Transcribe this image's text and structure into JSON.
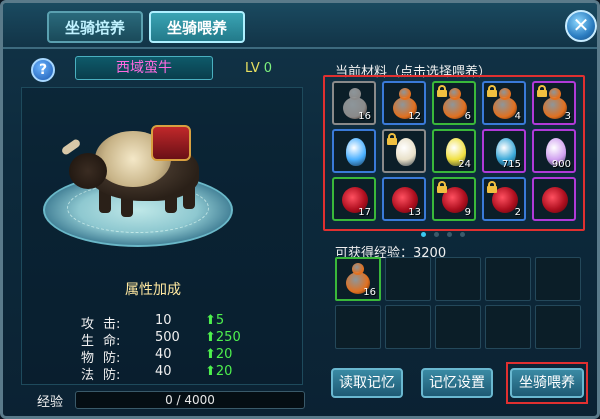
{
  "tabs": [
    {
      "label": "坐骑培养",
      "active": false
    },
    {
      "label": "坐骑喂养",
      "active": true
    }
  ],
  "close_icon": "close-icon",
  "help_icon": "help-icon",
  "mount": {
    "name": "西域蛮牛",
    "level_label": "LV",
    "level": "0"
  },
  "attributes": {
    "title": "属性加成",
    "rows": [
      {
        "key": "攻",
        "key2": "击:",
        "value": "10",
        "increase": "5"
      },
      {
        "key": "生",
        "key2": "命:",
        "value": "500",
        "increase": "250"
      },
      {
        "key": "物",
        "key2": "防:",
        "value": "40",
        "increase": "20"
      },
      {
        "key": "法",
        "key2": "防:",
        "value": "40",
        "increase": "20"
      }
    ]
  },
  "experience": {
    "label": "经验",
    "current": 0,
    "max": 4000,
    "text": "0 / 4000"
  },
  "materials": {
    "title": "当前材料（点击选择喂养）",
    "items": [
      {
        "type": "gourd",
        "quality": "gray",
        "qty": "16",
        "locked": false,
        "color": "#8a8a8a"
      },
      {
        "type": "gourd",
        "quality": "blue",
        "qty": "12",
        "locked": false,
        "color": "#e07020"
      },
      {
        "type": "gourd",
        "quality": "green",
        "qty": "6",
        "locked": true,
        "color": "#e07020"
      },
      {
        "type": "gourd",
        "quality": "blue",
        "qty": "4",
        "locked": true,
        "color": "#e07020"
      },
      {
        "type": "gourd",
        "quality": "purple",
        "qty": "3",
        "locked": true,
        "color": "#e07020"
      },
      {
        "type": "egg",
        "quality": "blue",
        "qty": "",
        "locked": false,
        "color": "#4ab0ff"
      },
      {
        "type": "egg",
        "quality": "gray",
        "qty": "",
        "locked": true,
        "color": "#e8e0c8"
      },
      {
        "type": "egg",
        "quality": "green",
        "qty": "24",
        "locked": false,
        "color": "#f0e040"
      },
      {
        "type": "egg",
        "quality": "purple",
        "qty": "715",
        "locked": false,
        "color": "#3aa8d8"
      },
      {
        "type": "egg",
        "quality": "purple",
        "qty": "900",
        "locked": false,
        "color": "#d0a0f0"
      },
      {
        "type": "rose",
        "quality": "green",
        "qty": "17",
        "locked": false,
        "color": "#c01020"
      },
      {
        "type": "rose",
        "quality": "blue",
        "qty": "13",
        "locked": false,
        "color": "#c01020"
      },
      {
        "type": "rose",
        "quality": "green",
        "qty": "9",
        "locked": true,
        "color": "#c01020"
      },
      {
        "type": "rose",
        "quality": "blue",
        "qty": "2",
        "locked": true,
        "color": "#c01020"
      },
      {
        "type": "rose",
        "quality": "purple",
        "qty": "",
        "locked": false,
        "color": "#c01020"
      }
    ],
    "page": 1,
    "pages": 4
  },
  "feed": {
    "gain_label": "可获得经验：",
    "gain_value": "3200",
    "gain_text": "可获得经验：3200",
    "slots": [
      {
        "type": "gourd",
        "qty": "16",
        "color": "#e07020"
      },
      null,
      null,
      null,
      null,
      null,
      null,
      null,
      null,
      null
    ]
  },
  "buttons": {
    "recall": "读取记忆",
    "setting": "记忆设置",
    "feed": "坐骑喂养"
  }
}
